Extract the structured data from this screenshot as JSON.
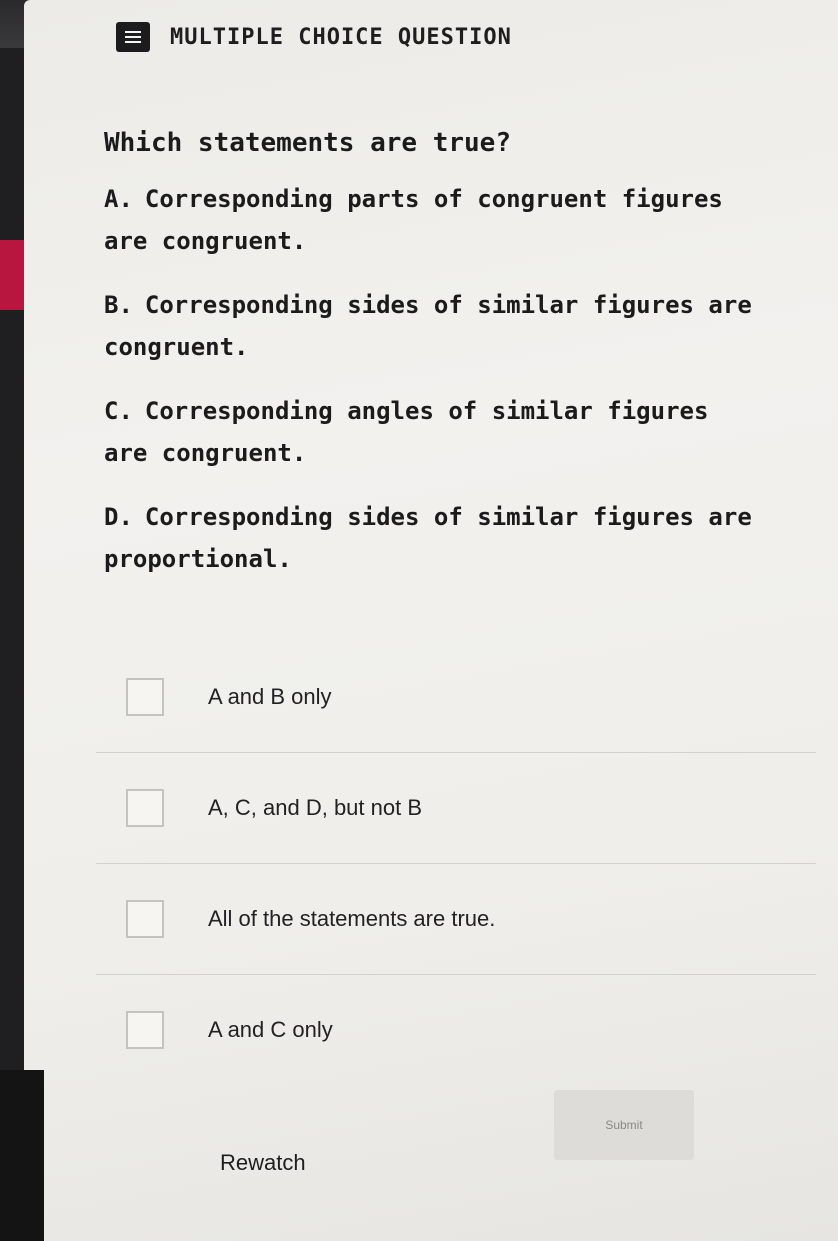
{
  "header": {
    "title": "MULTIPLE CHOICE QUESTION",
    "icon": "list-icon"
  },
  "question": {
    "prompt": "Which statements are true?",
    "statements": [
      {
        "letter": "A.",
        "text": "Corresponding parts of congruent figures are congruent."
      },
      {
        "letter": "B.",
        "text": "Corresponding sides of similar figures are congruent."
      },
      {
        "letter": "C.",
        "text": "Corresponding angles of similar figures are congruent."
      },
      {
        "letter": "D.",
        "text": "Corresponding sides of similar figures are proportional."
      }
    ]
  },
  "options": [
    {
      "label": "A and B only"
    },
    {
      "label": "A, C, and D, but not B"
    },
    {
      "label": "All of the statements are true."
    },
    {
      "label": "A and C only"
    }
  ],
  "actions": {
    "submit_label": "Submit",
    "rewatch_label": "Rewatch"
  },
  "colors": {
    "accent": "#b8163f",
    "card": "#efeeea",
    "text": "#1b1b1b"
  }
}
